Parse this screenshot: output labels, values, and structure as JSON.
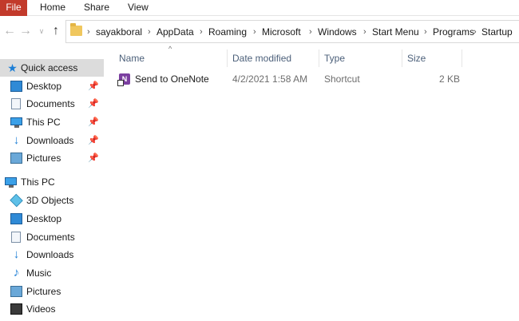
{
  "ribbon": {
    "tabs": [
      "File",
      "Home",
      "Share",
      "View"
    ]
  },
  "address": {
    "breadcrumbs": [
      "sayakboral",
      "AppData",
      "Roaming",
      "Microsoft",
      "Windows",
      "Start Menu",
      "Programs",
      "Startup"
    ]
  },
  "nav_buttons": {
    "back_icon": "arrow-left-icon",
    "forward_icon": "arrow-right-icon",
    "recent_icon": "chevron-down-icon",
    "up_icon": "arrow-up-icon"
  },
  "navpane": {
    "quick_access": {
      "label": "Quick access",
      "items": [
        {
          "label": "Desktop",
          "icon": "desktop-icon",
          "pinned": true
        },
        {
          "label": "Documents",
          "icon": "documents-icon",
          "pinned": true
        },
        {
          "label": "This PC",
          "icon": "this-pc-icon",
          "pinned": true
        },
        {
          "label": "Downloads",
          "icon": "downloads-icon",
          "pinned": true
        },
        {
          "label": "Pictures",
          "icon": "pictures-icon",
          "pinned": true
        }
      ]
    },
    "this_pc": {
      "label": "This PC",
      "items": [
        {
          "label": "3D Objects",
          "icon": "3d-objects-icon"
        },
        {
          "label": "Desktop",
          "icon": "desktop-icon"
        },
        {
          "label": "Documents",
          "icon": "documents-icon"
        },
        {
          "label": "Downloads",
          "icon": "downloads-icon"
        },
        {
          "label": "Music",
          "icon": "music-icon"
        },
        {
          "label": "Pictures",
          "icon": "pictures-icon"
        },
        {
          "label": "Videos",
          "icon": "videos-icon"
        }
      ]
    }
  },
  "file_list": {
    "columns": [
      "Name",
      "Date modified",
      "Type",
      "Size"
    ],
    "rows": [
      {
        "name": "Send to OneNote",
        "date_modified": "4/2/2021 1:58 AM",
        "type": "Shortcut",
        "size": "2 KB",
        "icon": "onenote-shortcut-icon"
      }
    ]
  },
  "colors": {
    "file_tab": "#c23a2b",
    "selection": "#dcdcdc",
    "header_text": "#4c607a",
    "accent": "#1e7fd6"
  }
}
